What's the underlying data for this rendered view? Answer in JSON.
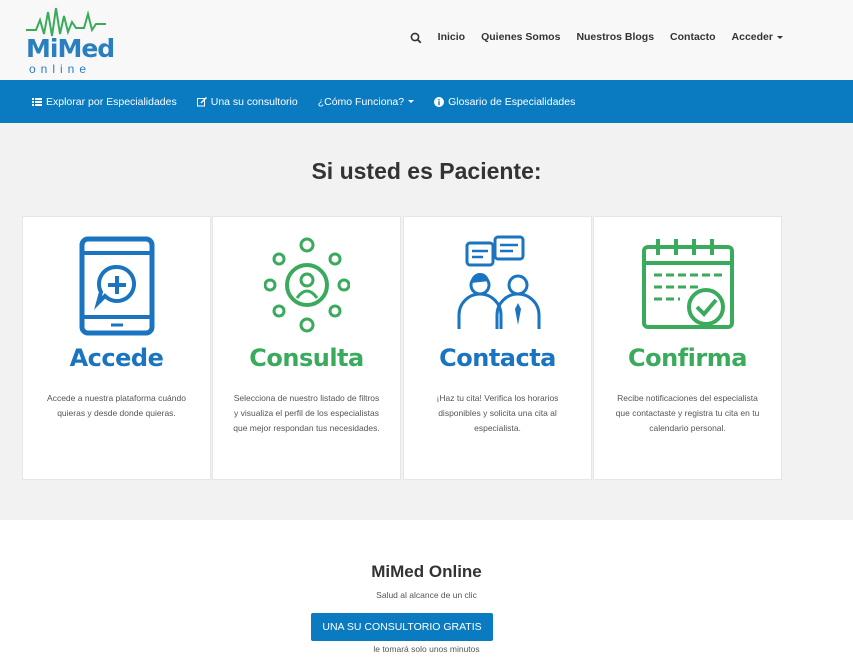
{
  "brand": {
    "logo_main_mi": "Mi",
    "logo_main_med": "Med",
    "logo_sub": "online"
  },
  "topnav": {
    "items": [
      "Inicio",
      "Quienes Somos",
      "Nuestros Blogs",
      "Contacto"
    ],
    "acceder": "Acceder"
  },
  "bluenav": {
    "explorar": "Explorar por Especialidades",
    "una": "Una su consultorio",
    "como": "¿Cómo Funciona?",
    "glosario": "Glosario de Especialidades"
  },
  "section": {
    "title": "Si usted es Paciente:",
    "cards": [
      {
        "title": "Accede",
        "desc": "Accede a nuestra plataforma cuándo quieras y desde donde quieras."
      },
      {
        "title": "Consulta",
        "desc": "Selecciona de nuestro listado de filtros y visualiza el perfil de los especialistas que mejor respondan tus necesidades."
      },
      {
        "title": "Contacta",
        "desc": "¡Haz tu cita! Verifica los horarios disponibles y solicita una cita al especialista."
      },
      {
        "title": "Confirma",
        "desc": "Recibe notificaciones del especialista que contactaste y registra tu cita en tu calendario personal."
      }
    ]
  },
  "footer": {
    "title": "MiMed Online",
    "subtitle": "Salud al alcance de un clic",
    "button": "UNA SU CONSULTORIO GRATIS",
    "note": "le tomará solo unos minutos"
  },
  "colors": {
    "primary": "#0b7bc1",
    "icon_blue": "#1a74c0",
    "icon_green": "#3aaa5c"
  },
  "icons": [
    "search-icon",
    "list-icon",
    "edit-icon",
    "info-icon",
    "tablet-plus-icon",
    "user-network-icon",
    "chat-people-icon",
    "calendar-check-icon"
  ]
}
